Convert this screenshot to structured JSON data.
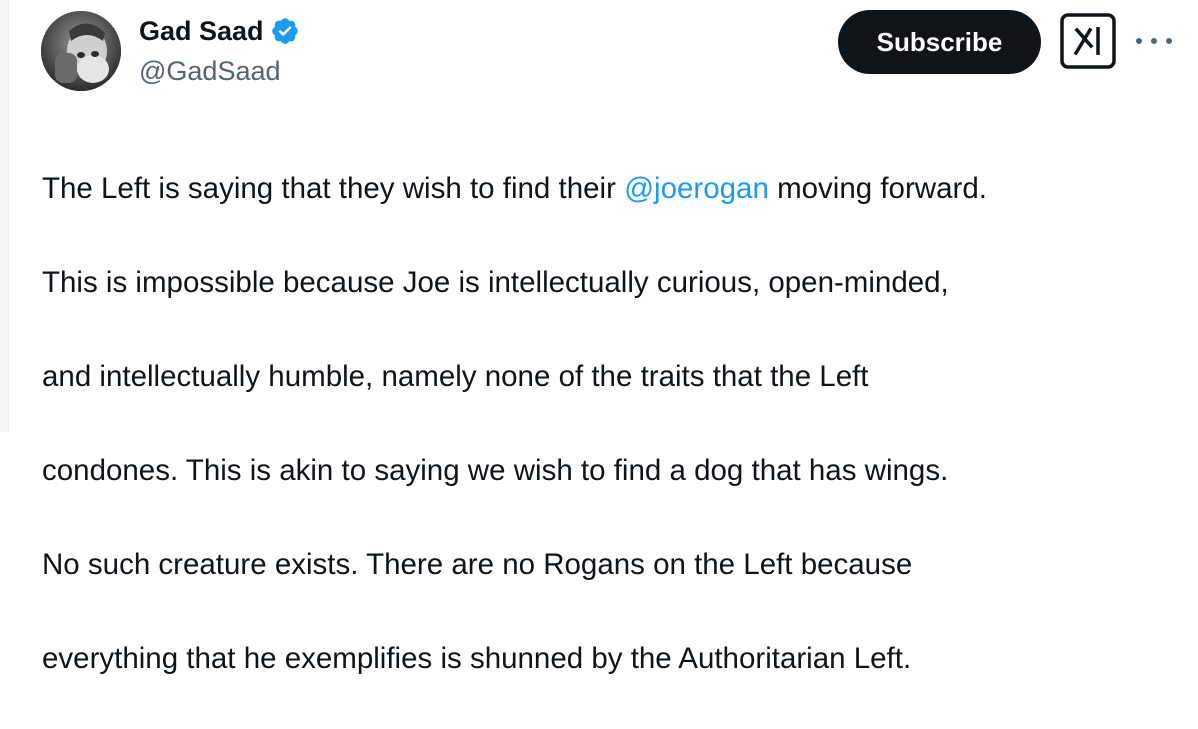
{
  "author": {
    "display_name": "Gad Saad",
    "handle": "@GadSaad",
    "verified": true,
    "verified_color": "#1d9bf0"
  },
  "actions": {
    "subscribe_label": "Subscribe",
    "grok_icon": "grok-icon",
    "more_icon": "more-dots-icon"
  },
  "tweet": {
    "line1_before": "The Left is saying that they wish to find their ",
    "mention": "@joerogan",
    "line1_after": " moving forward.",
    "line2": "This is impossible because Joe is intellectually curious, open-minded,",
    "line3": "and intellectually humble, namely none of the traits that the Left",
    "line4": "condones.  This is akin to saying we wish to find a dog that has wings.",
    "line5": "No such creature exists.  There are no Rogans on the Left because",
    "line6": "everything that he exemplifies is shunned by the Authoritarian Left."
  },
  "colors": {
    "text": "#0f1419",
    "secondary": "#536471",
    "link": "#1d9bf0",
    "button_bg": "#0f1419"
  }
}
